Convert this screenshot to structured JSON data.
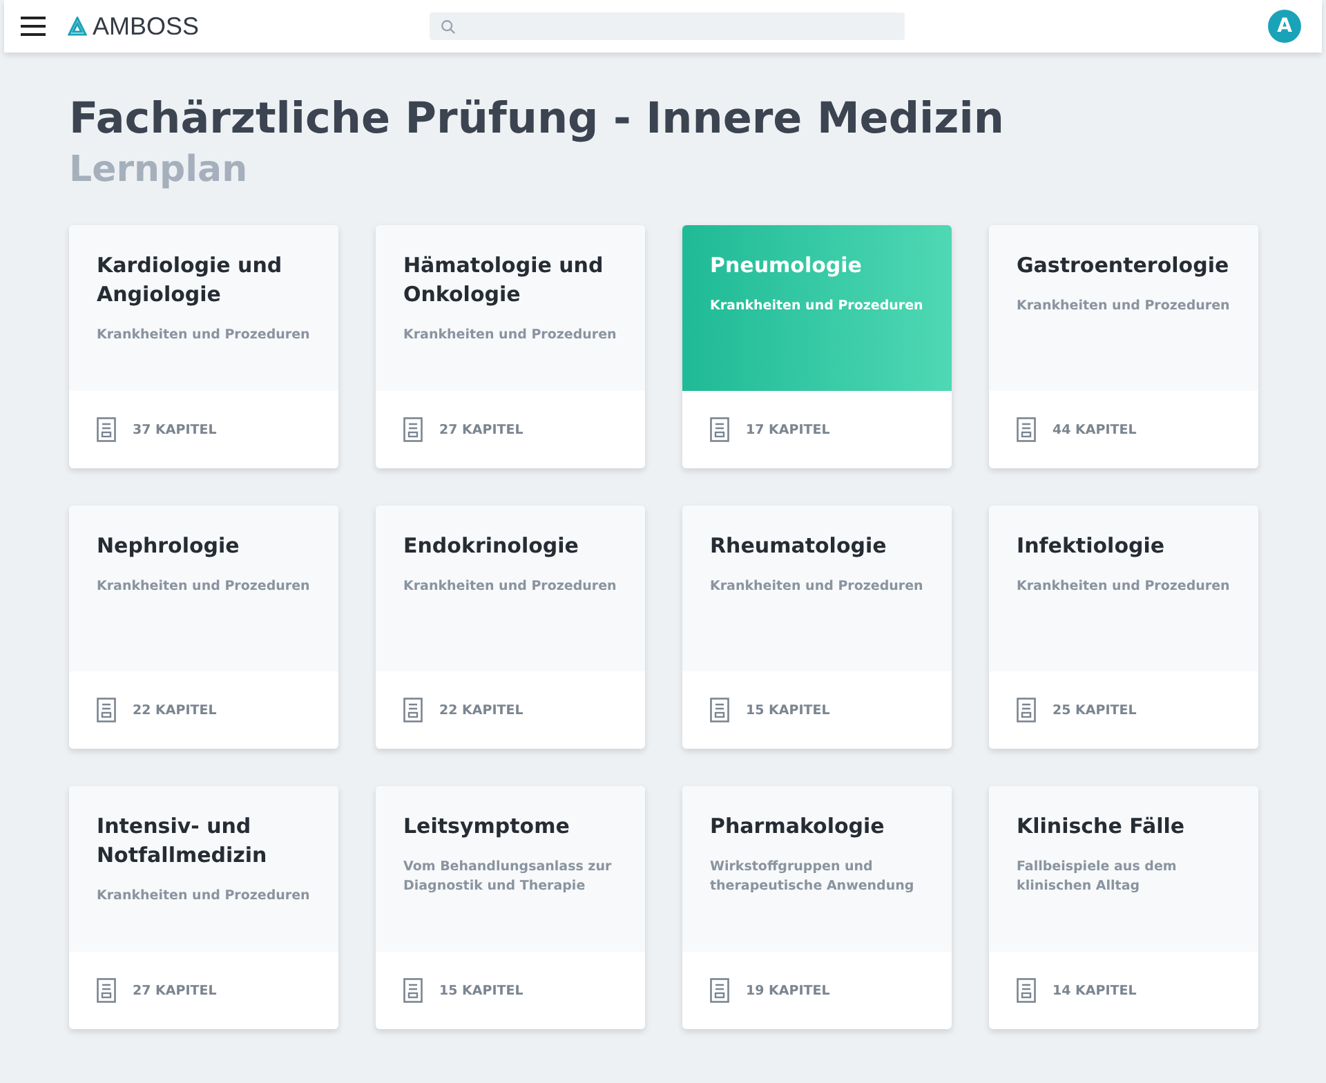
{
  "header": {
    "brand": "AMBOSS",
    "avatar": "A"
  },
  "page": {
    "title": "Fachärztliche Prüfung - Innere Medizin",
    "subtitle": "Lernplan"
  },
  "cards": [
    {
      "title": "Kardiologie und Angiologie",
      "description": "Krankheiten und Prozeduren",
      "chapters": "37 KAPITEL",
      "selected": false
    },
    {
      "title": "Hämatologie und Onkologie",
      "description": "Krankheiten und Prozeduren",
      "chapters": "27 KAPITEL",
      "selected": false
    },
    {
      "title": "Pneumologie",
      "description": "Krankheiten und Prozeduren",
      "chapters": "17 KAPITEL",
      "selected": true
    },
    {
      "title": "Gastroenterologie",
      "description": "Krankheiten und Prozeduren",
      "chapters": "44 KAPITEL",
      "selected": false
    },
    {
      "title": "Nephrologie",
      "description": "Krankheiten und Prozeduren",
      "chapters": "22 KAPITEL",
      "selected": false
    },
    {
      "title": "Endokrinologie",
      "description": "Krankheiten und Prozeduren",
      "chapters": "22 KAPITEL",
      "selected": false
    },
    {
      "title": "Rheumatologie",
      "description": "Krankheiten und Prozeduren",
      "chapters": "15 KAPITEL",
      "selected": false
    },
    {
      "title": "Infektiologie",
      "description": "Krankheiten und Prozeduren",
      "chapters": "25 KAPITEL",
      "selected": false
    },
    {
      "title": "Intensiv- und Notfallmedizin",
      "description": "Krankheiten und Prozeduren",
      "chapters": "27 KAPITEL",
      "selected": false
    },
    {
      "title": "Leitsymptome",
      "description": "Vom Behandlungsanlass zur Diagnostik und Therapie",
      "chapters": "15 KAPITEL",
      "selected": false
    },
    {
      "title": "Pharmakologie",
      "description": "Wirkstoffgruppen und therapeutische Anwendung",
      "chapters": "19 KAPITEL",
      "selected": false
    },
    {
      "title": "Klinische Fälle",
      "description": "Fallbeispiele aus dem klinischen Alltag",
      "chapters": "14 KAPITEL",
      "selected": false
    }
  ]
}
